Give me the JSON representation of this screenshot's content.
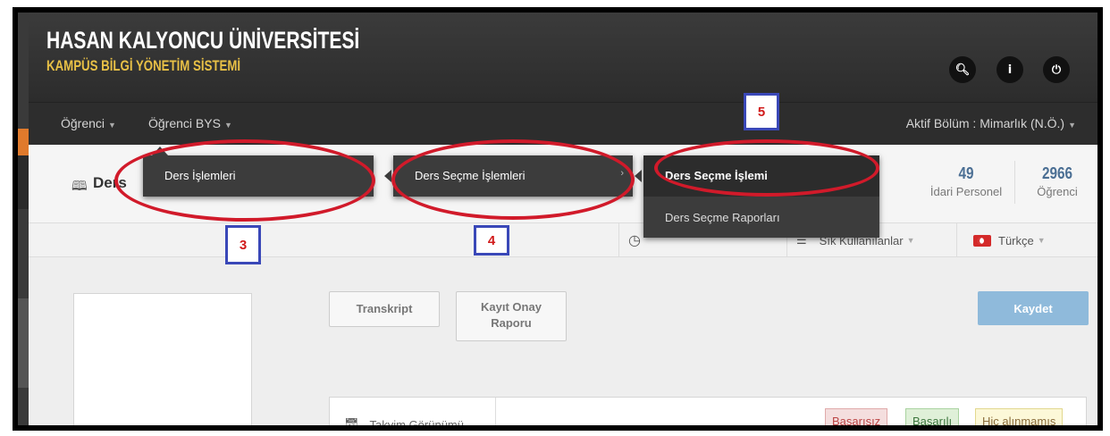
{
  "header": {
    "university": "HASAN KALYONCU ÜNİVERSİTESİ",
    "system": "KAMPÜS BİLGİ YÖNETİM SİSTEMİ",
    "search_icon": "search-icon",
    "info_icon": "info-icon",
    "power_icon": "power-icon"
  },
  "nav": {
    "ogrenci": "Öğrenci",
    "ogrenci_bys": "Öğrenci BYS",
    "aktif": "Aktif Bölüm : Mimarlık (N.Ö.)"
  },
  "subheader": {
    "breadcrumb": "Ders",
    "stats": [
      {
        "value": "49",
        "label": "İdari Personel"
      },
      {
        "value": "2966",
        "label": "Öğrenci"
      }
    ]
  },
  "toolbar": {
    "item2": "Sık Kullanılanlar",
    "language": "Türkçe"
  },
  "main": {
    "transkript": "Transkript",
    "kayit_onay": "Kayıt Onay Raporu",
    "kaydet": "Kaydet",
    "takvim": "Takvim Görünümü",
    "basarisiz": "Başarısız",
    "basarili": "Başarılı",
    "hic": "Hiç alınmamış"
  },
  "menus": {
    "level1": [
      "Ders İşlemleri"
    ],
    "level2": [
      "Ders Seçme İşlemleri"
    ],
    "level3": [
      "Ders Seçme İşlemi",
      "Ders Seçme Raporları"
    ]
  },
  "annotations": {
    "n3": "3",
    "n4": "4",
    "n5": "5"
  },
  "colors": {
    "header_bg": "#333333",
    "system_title": "#e8c046",
    "highlight_red": "#d11a2a",
    "label_blue": "#3a48b8",
    "kaydet_bg": "#8fbadb"
  }
}
